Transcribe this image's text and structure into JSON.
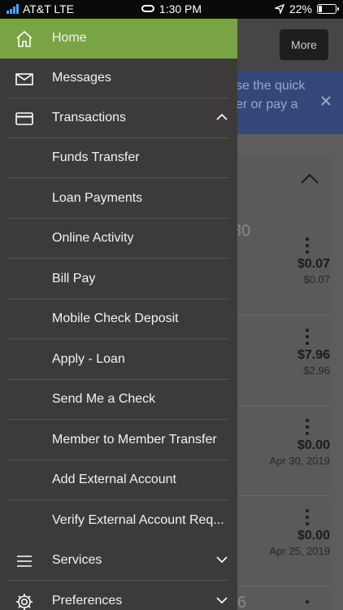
{
  "status_bar": {
    "carrier": "AT&T LTE",
    "time": "1:30 PM",
    "battery": "22%",
    "battery_level": 0.22
  },
  "background": {
    "more_label": "More",
    "banner_line1": "se the quick",
    "banner_line2": "er or pay a",
    "partial_value": "30",
    "transactions": [
      {
        "amount": "$0.07",
        "sub": "$0.07"
      },
      {
        "amount": "$7.96",
        "sub": "$2.96"
      },
      {
        "amount": "$0.00",
        "sub": "Apr 30, 2019"
      },
      {
        "amount": "$0.00",
        "sub": "Apr 25, 2019"
      }
    ],
    "partial_bottom": "6"
  },
  "drawer": {
    "items": [
      {
        "label": "Home",
        "icon": "home-icon",
        "active": true
      },
      {
        "label": "Messages",
        "icon": "envelope-icon"
      },
      {
        "label": "Transactions",
        "icon": "card-icon",
        "expanded": true
      },
      {
        "label": "Funds Transfer"
      },
      {
        "label": "Loan Payments"
      },
      {
        "label": "Online Activity"
      },
      {
        "label": "Bill Pay"
      },
      {
        "label": "Mobile Check Deposit"
      },
      {
        "label": "Apply - Loan"
      },
      {
        "label": "Send Me a Check"
      },
      {
        "label": "Member to Member Transfer"
      },
      {
        "label": "Add External Account"
      },
      {
        "label": "Verify External Account Req..."
      },
      {
        "label": "Services",
        "icon": "hamburger-icon"
      },
      {
        "label": "Preferences",
        "icon": "gear-icon"
      }
    ]
  },
  "colors": {
    "active": "#79a443",
    "drawer_bg": "#3d3b39",
    "banner": "#33477a"
  }
}
